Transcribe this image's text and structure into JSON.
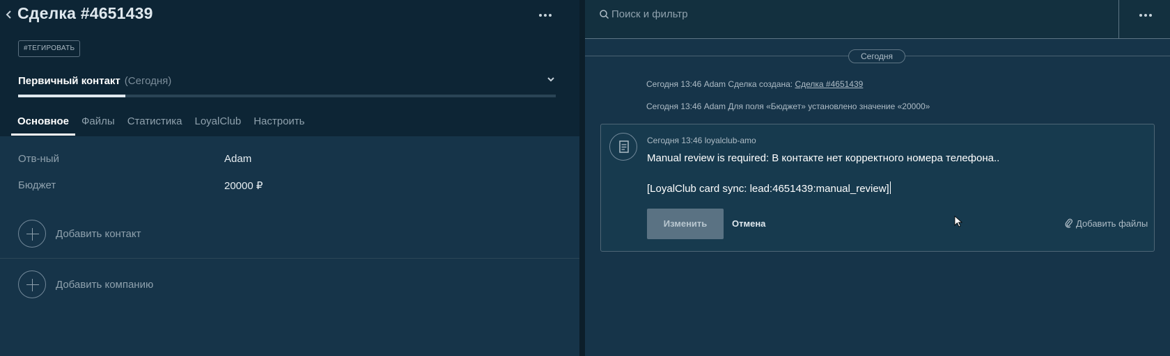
{
  "left": {
    "title": "Сделка #4651439",
    "tag_button": "#ТЕГИРОВАТЬ",
    "pipeline_stage": "Первичный контакт",
    "pipeline_when": "(Сегодня)",
    "tabs": [
      "Основное",
      "Файлы",
      "Статистика",
      "LoyalClub",
      "Настроить"
    ],
    "active_tab": "Основное",
    "fields": [
      {
        "label": "Отв-ный",
        "value": "Adam"
      },
      {
        "label": "Бюджет",
        "value": "20000 ₽"
      }
    ],
    "add_contact": "Добавить контакт",
    "add_company": "Добавить компанию"
  },
  "right": {
    "search_placeholder": "Поиск и фильтр",
    "date_pill": "Сегодня",
    "events": [
      {
        "time": "Сегодня 13:46",
        "author": "Adam",
        "text": "Сделка создана:",
        "link": "Сделка #4651439"
      },
      {
        "time": "Сегодня 13:46",
        "author": "Adam",
        "text": "Для поля «Бюджет» установлено значение «20000»"
      }
    ],
    "note": {
      "meta": "Сегодня 13:46 loyalclub-amo",
      "line1": "Manual review is required: В контакте нет корректного номера телефона..",
      "line2": "[LoyalClub card sync: lead:4651439:manual_review]",
      "save_label": "Изменить",
      "cancel_label": "Отмена",
      "attach_label": "Добавить файлы"
    }
  },
  "colors": {
    "panel": "#163449",
    "header": "#0d2535",
    "text": "#e6edf1",
    "muted": "#8fa1ad",
    "button": "#5a7283"
  },
  "icons": [
    "chevron-left-icon",
    "more-dots-icon",
    "chevron-down-icon",
    "plus-circle-icon",
    "search-icon",
    "note-document-icon",
    "paperclip-icon",
    "mouse-cursor-icon"
  ]
}
